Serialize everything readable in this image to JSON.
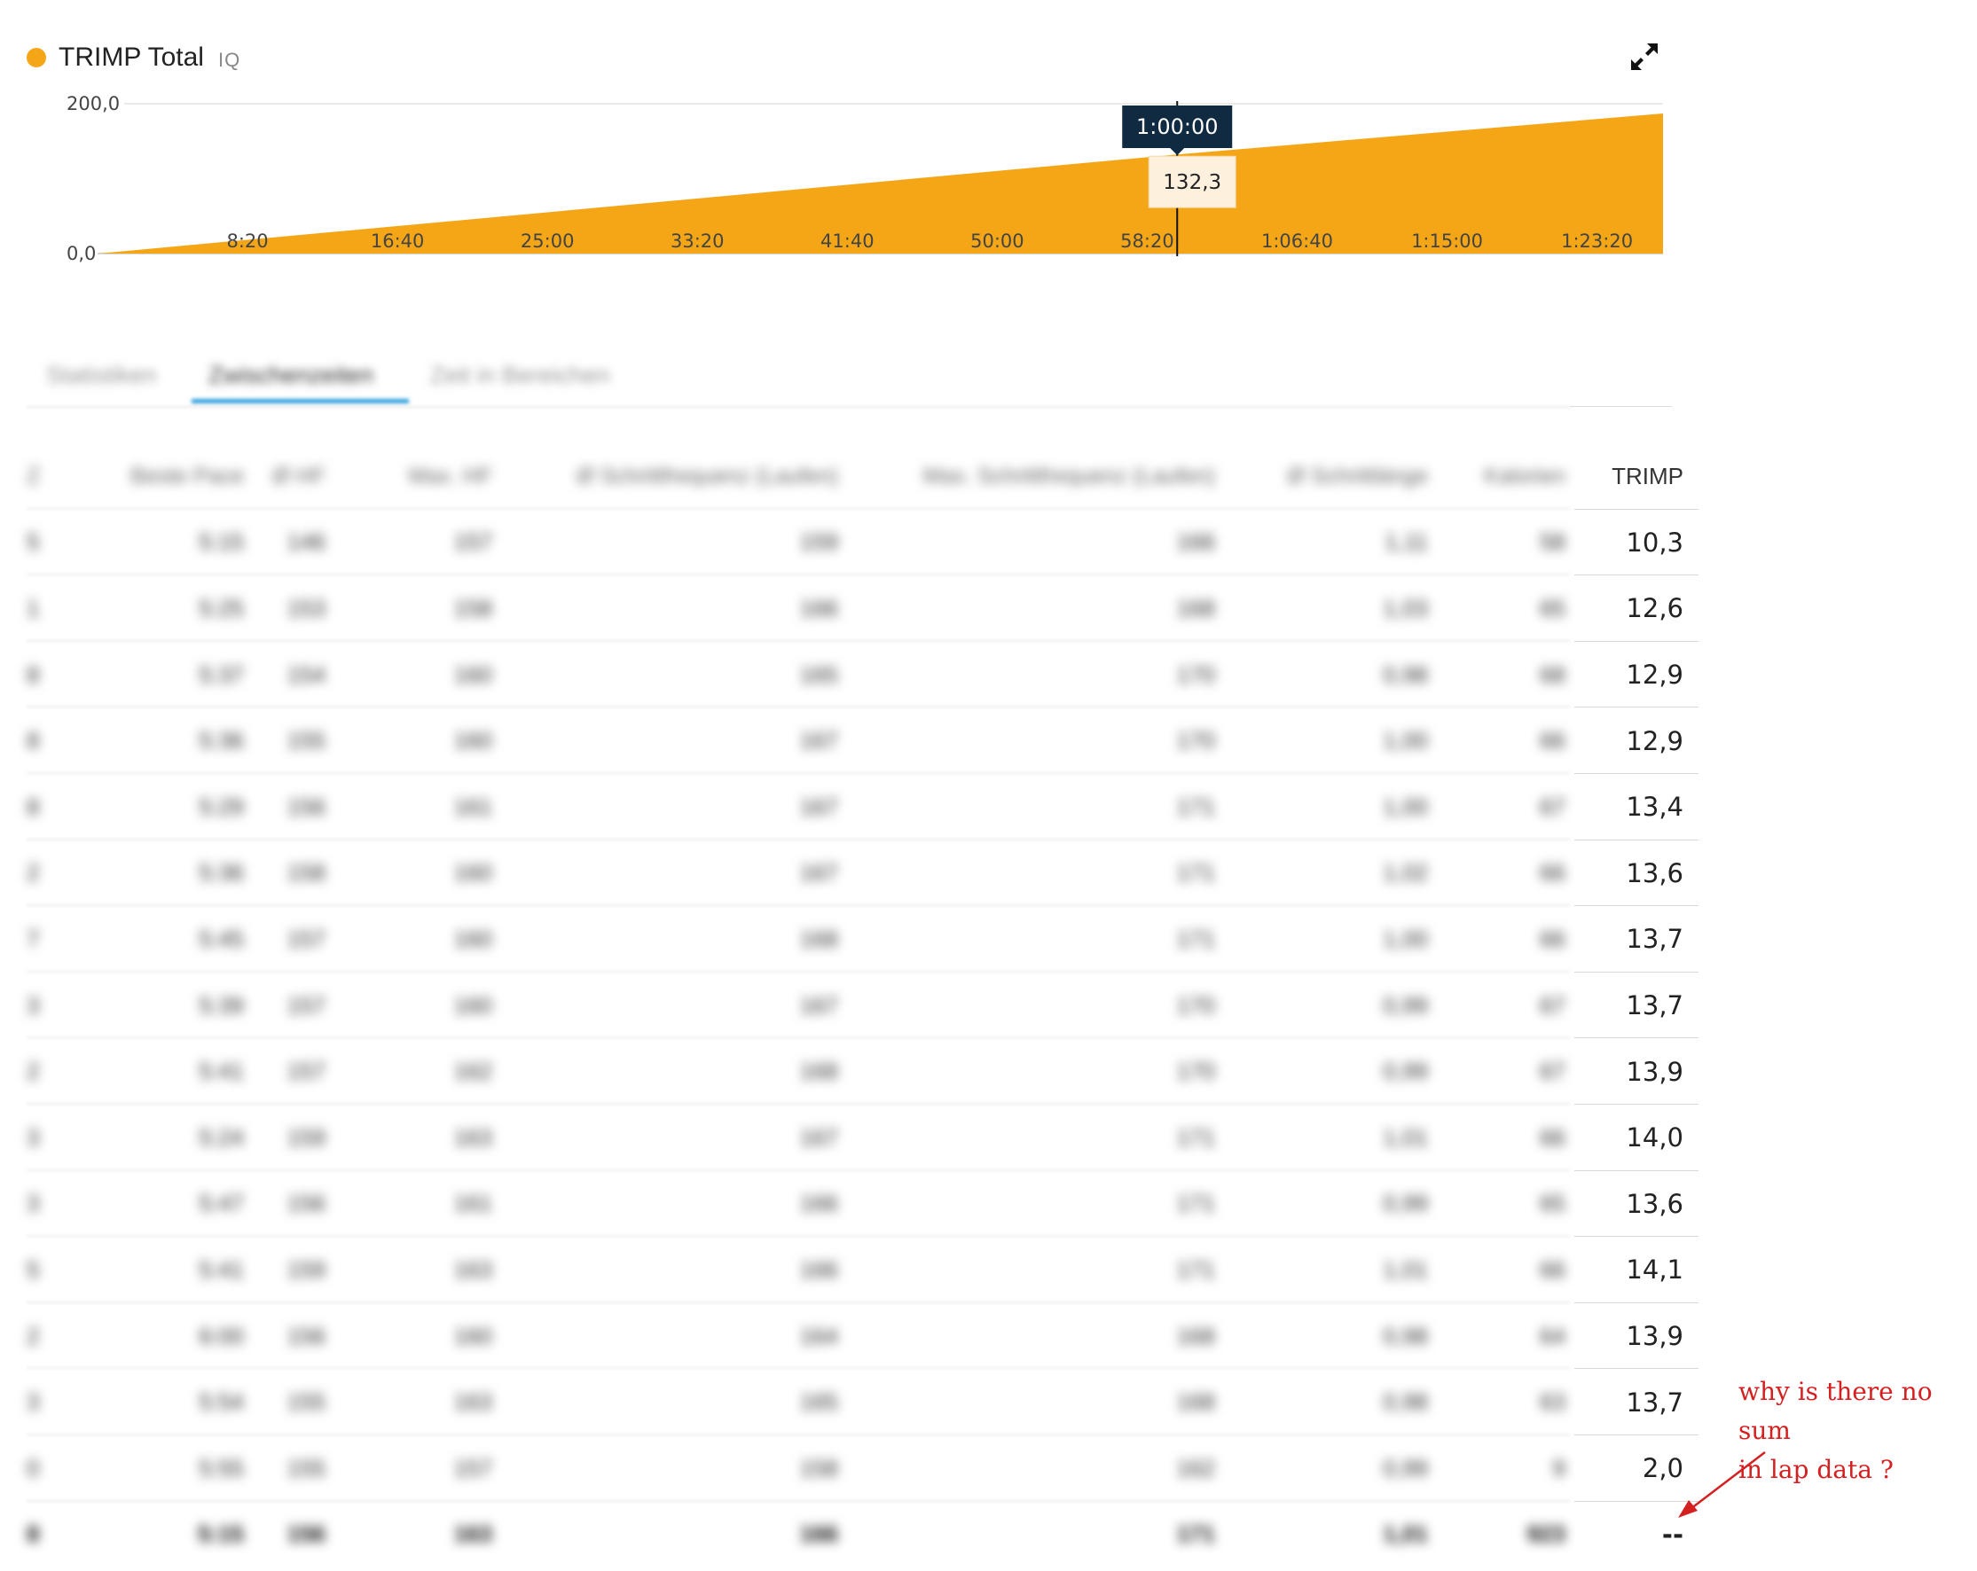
{
  "chart": {
    "title": "TRIMP Total",
    "badge": "IQ",
    "expand_icon": "expand-icon",
    "accent_color": "#f5a617",
    "tooltip": {
      "time": "1:00:00",
      "value": "132,3"
    }
  },
  "chart_data": {
    "type": "area",
    "title": "TRIMP Total",
    "x_tick_labels": [
      "8:20",
      "16:40",
      "25:00",
      "33:20",
      "41:40",
      "50:00",
      "58:20",
      "1:06:40",
      "1:15:00",
      "1:23:20"
    ],
    "y_tick_labels": [
      "200,0",
      "0,0"
    ],
    "ylim": [
      0,
      200
    ],
    "xlim": [
      "0:00",
      "1:27:00"
    ],
    "series": [
      {
        "x": [
          "0:00",
          "1:00:00",
          "1:27:00"
        ],
        "values": [
          0,
          132.3,
          187
        ]
      }
    ],
    "cursor_x": "1:00:00",
    "grid": false
  },
  "tabs": [
    {
      "label": "Statistiken",
      "active": false
    },
    {
      "label": "Zwischenzeiten",
      "active": true
    },
    {
      "label": "Zeit in Bereichen",
      "active": false
    }
  ],
  "table": {
    "headers": [
      "Z",
      "Beste Pace",
      "Ø HF",
      "Max. HF",
      "Ø Schrittfrequenz (Laufen)",
      "Max. Schrittfrequenz (Laufen)",
      "Ø Schrittlänge",
      "Kalorien",
      "TRIMP"
    ],
    "rows": [
      [
        "5",
        "5:15",
        "146",
        "157",
        "159",
        "166",
        "1,11",
        "58",
        "10,3"
      ],
      [
        "1",
        "5:25",
        "153",
        "158",
        "166",
        "168",
        "1,03",
        "65",
        "12,6"
      ],
      [
        "8",
        "5:37",
        "154",
        "160",
        "165",
        "170",
        "0,98",
        "68",
        "12,9"
      ],
      [
        "8",
        "5:36",
        "155",
        "160",
        "167",
        "170",
        "1,00",
        "66",
        "12,9"
      ],
      [
        "8",
        "5:29",
        "156",
        "161",
        "167",
        "171",
        "1,00",
        "67",
        "13,4"
      ],
      [
        "2",
        "5:36",
        "158",
        "160",
        "167",
        "171",
        "1,02",
        "66",
        "13,6"
      ],
      [
        "7",
        "5:45",
        "157",
        "160",
        "168",
        "171",
        "1,00",
        "66",
        "13,7"
      ],
      [
        "3",
        "5:39",
        "157",
        "160",
        "167",
        "170",
        "0,99",
        "67",
        "13,7"
      ],
      [
        "2",
        "5:41",
        "157",
        "162",
        "168",
        "170",
        "0,99",
        "67",
        "13,9"
      ],
      [
        "3",
        "5:24",
        "159",
        "163",
        "167",
        "171",
        "1,01",
        "66",
        "14,0"
      ],
      [
        "3",
        "5:47",
        "156",
        "161",
        "166",
        "171",
        "0,99",
        "65",
        "13,6"
      ],
      [
        "5",
        "5:41",
        "159",
        "163",
        "166",
        "171",
        "1,01",
        "66",
        "14,1"
      ],
      [
        "2",
        "6:00",
        "156",
        "160",
        "164",
        "168",
        "0,98",
        "64",
        "13,9"
      ],
      [
        "3",
        "5:54",
        "155",
        "163",
        "165",
        "168",
        "0,98",
        "63",
        "13,7"
      ],
      [
        "0",
        "5:55",
        "155",
        "157",
        "158",
        "162",
        "0,99",
        "9",
        "2,0"
      ]
    ],
    "total": [
      "8",
      "5:15",
      "156",
      "163",
      "166",
      "171",
      "1,01",
      "923",
      "--"
    ]
  },
  "annotation": {
    "line1": "why is there no sum",
    "line2": "in lap data ?",
    "color": "#d42020"
  }
}
